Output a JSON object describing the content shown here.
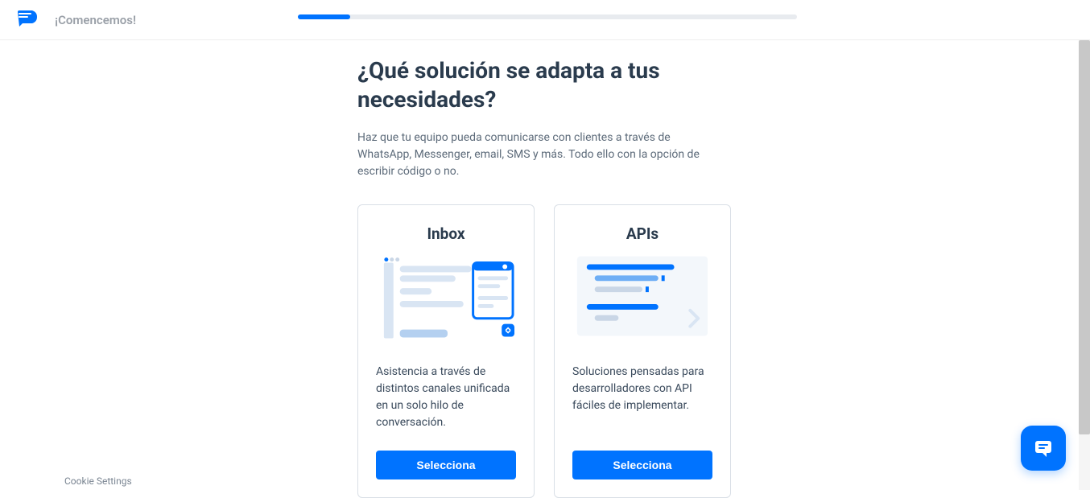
{
  "header": {
    "title": "¡Comencemos!"
  },
  "main": {
    "title": "¿Qué solución se adapta a tus necesidades?",
    "subtitle": "Haz que tu equipo pueda comunicarse con clientes a través de WhatsApp, Messenger, email, SMS y más. Todo ello con la opción de escribir código o no."
  },
  "cards": {
    "inbox": {
      "title": "Inbox",
      "description": "Asistencia a través de distintos canales unificada en un solo hilo de conversación.",
      "button": "Selecciona"
    },
    "apis": {
      "title": "APIs",
      "description": "Soluciones pensadas para desarrolladores con API fáciles de implementar.",
      "button": "Selecciona"
    }
  },
  "footer": {
    "cookie": "Cookie Settings"
  }
}
